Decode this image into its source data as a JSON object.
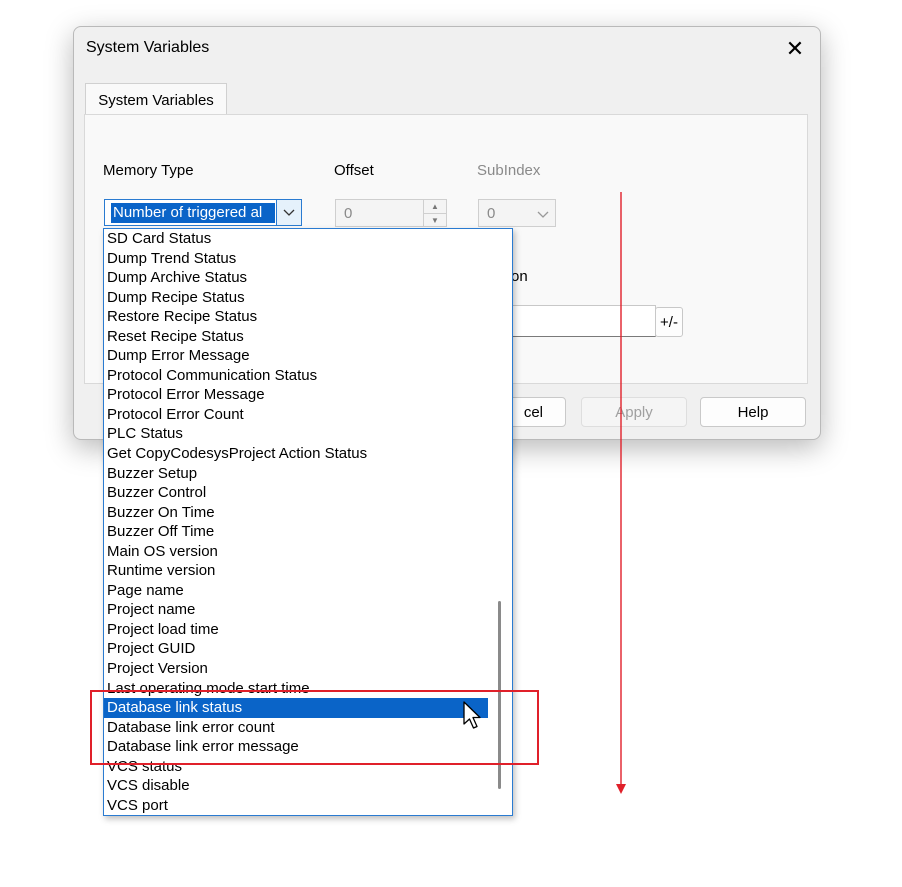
{
  "dialog": {
    "title": "System Variables",
    "close_glyph": "✕",
    "tab_label": "System Variables",
    "memory_type": {
      "label": "Memory Type",
      "selected_text": "Number of triggered al"
    },
    "offset": {
      "label": "Offset",
      "value": "0"
    },
    "subindex": {
      "label": "SubIndex",
      "value": "0"
    },
    "partial_label": "on",
    "plus_minus": "+/-",
    "buttons": {
      "cancel": "cel",
      "apply": "Apply",
      "help": "Help"
    }
  },
  "dropdown": {
    "items": [
      "SD Card Status",
      "Dump Trend Status",
      "Dump Archive Status",
      "Dump Recipe Status",
      "Restore Recipe Status",
      "Reset Recipe Status",
      "Dump Error Message",
      "Protocol Communication Status",
      "Protocol Error Message",
      "Protocol Error Count",
      "PLC Status",
      "Get CopyCodesysProject Action Status",
      "Buzzer Setup",
      "Buzzer Control",
      "Buzzer On Time",
      "Buzzer Off Time",
      "Main OS version",
      "Runtime version",
      "Page name",
      "Project name",
      "Project load time",
      "Project GUID",
      "Project Version",
      "Last operating mode start time",
      "Database link status",
      "Database link error count",
      "Database link error message",
      "VCS status",
      "VCS disable",
      "VCS port"
    ],
    "selected_index": 24
  },
  "annotation": {
    "highlight_color": "#e0202a",
    "arrow_color": "#e0202a"
  },
  "colors": {
    "selection": "#0a64c8",
    "focus_border": "#2a7bd1"
  }
}
